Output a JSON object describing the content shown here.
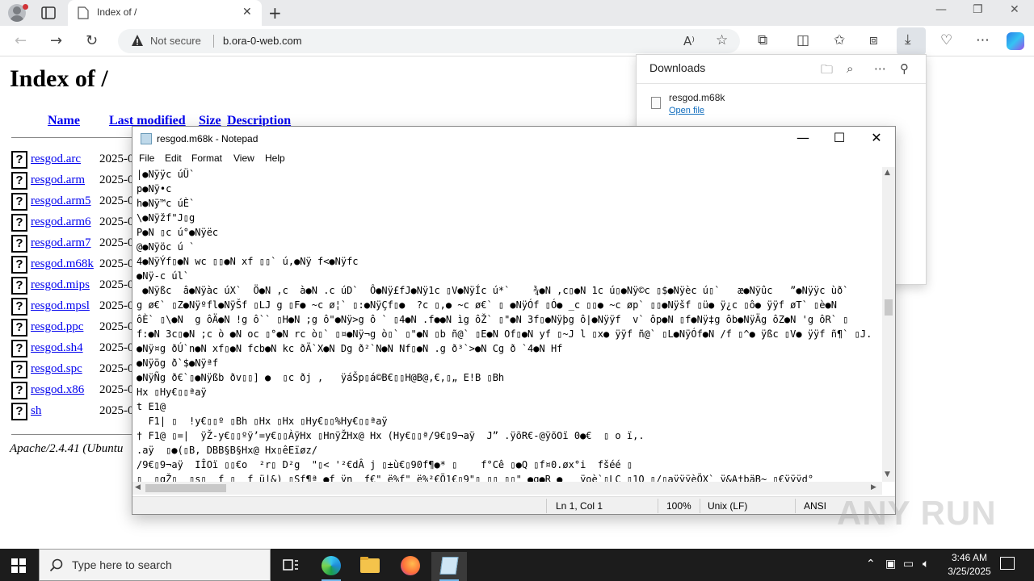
{
  "browser": {
    "tab_title": "Index of /",
    "address": {
      "security_label": "Not secure",
      "url": "b.ora-0-web.com"
    }
  },
  "page": {
    "heading": "Index of /",
    "columns": [
      "Name",
      "Last modified",
      "Size",
      "Description"
    ],
    "files": [
      {
        "name": "resgod.arc",
        "date": "2025-0"
      },
      {
        "name": "resgod.arm",
        "date": "2025-0"
      },
      {
        "name": "resgod.arm5",
        "date": "2025-0"
      },
      {
        "name": "resgod.arm6",
        "date": "2025-0"
      },
      {
        "name": "resgod.arm7",
        "date": "2025-0"
      },
      {
        "name": "resgod.m68k",
        "date": "2025-0"
      },
      {
        "name": "resgod.mips",
        "date": "2025-0"
      },
      {
        "name": "resgod.mpsl",
        "date": "2025-0"
      },
      {
        "name": "resgod.ppc",
        "date": "2025-0"
      },
      {
        "name": "resgod.sh4",
        "date": "2025-0"
      },
      {
        "name": "resgod.spc",
        "date": "2025-0"
      },
      {
        "name": "resgod.x86",
        "date": "2025-0"
      },
      {
        "name": "sh",
        "date": "2025-0"
      }
    ],
    "footer": "Apache/2.4.41 (Ubuntu"
  },
  "downloads": {
    "title": "Downloads",
    "items": [
      {
        "filename": "resgod.m68k",
        "action": "Open file"
      }
    ]
  },
  "notepad": {
    "title": "resgod.m68k - Notepad",
    "menu": [
      "File",
      "Edit",
      "Format",
      "View",
      "Help"
    ],
    "lines": [
      "|●Nÿÿc úÜ`",
      "p●Nÿ•c",
      "h●Nÿ™c úÈ`",
      "\\●Nÿžf\"J▯g",
      "P●N ▯c ú°●Nÿëc",
      "@●Nÿöc ú `",
      "4●NÿÝf▯●N wc ▯▯●N xf ▯▯` ú,●Nÿ f<●Nÿfc",
      "●Nÿ-c úl`",
      " ●Nÿßc  â●Nÿàc úX`  Ö●N ,c  à●N .c úD`  Ô●Nÿ£fJ●Nÿ1c ▯V●NÿÍc ú*`    ¾●N ,c▯●N 1c ú▯●Nÿ©c ▯$●Nÿèc ú▯`   æ●Nÿûc   ”●Nÿÿc ùð`",
      "g ø€` ▯Z●Nÿºfl●NÿŠf ▯LJ g ▯F● ~c ø¦` ▯:●NÿÇf▯●  ?c ▯,● ~c ø€` ▯ ●NÿÓf ▯Ó● _c ▯▯● ~c øp` ▯▯●Nÿšf ▯ü● ÿ¿c ▯ô● ÿÿf øT` ▯è●N",
      "ôÈ` ▯\\●N  g ôÄ●N !g ô`` ▯H●N ;g ô\"●Nÿ>g ô ` ▯4●N .f●●N ìg ôŽ` ▯\"●N 3f▯●Nÿþg ô|●Nÿÿf  v` ôp●N ▯f●Nÿ‡g ôb●NÿÄg ôZ●N 'g ôR` ▯",
      "f:●N 3c▯●N ;c ò ●N oc ▯°●N rc ò▯` ▯¤●Nÿ¬g ò▯` ▯\"●N ▯b ñ@` ▯E●N Of▯●N yf ▯~J l ▯x● ÿÿf ñ@` ▯L●NÿÓf●N /f ▯^● ÿßc ▯V● ÿÿf ñ¶` ▯J.",
      "●Nÿ¤g ðÚ`n●N xf▯●N fcb●N kc ðÄ`X●N Dg ð²`N●N Nf▯●N .g ð³`>●N Cg ð `4●N Hf",
      "●Nÿög ð`$●Nÿªf",
      "●NÿÑg ð€`▯●Nÿßb ðv▯▯] ●  ▯c ðj ,   ÿáŠp▯á©B€▯▯H@B@,€,▯„ E!B ▯Bh",
      "Hx ▯Hy€▯▯ªaÿ",
      "t E1@",
      "  F1| ▯  !y€▯▯º ▯Bh ▯Hx ▯Hx ▯Hy€▯▯%Hy€▯▯ªaÿ",
      "† F1@ ▯=|  ÿŽ-y€▯▯ºÿ’=y€▯▯ÀÿHx ▯HnÿŽHx@ Hx (Hy€▯▯ª/9€▯9¬aÿ  J” .ÿõR€-@ÿõOï 0●€  ▯ o ï,.",
      ".aÿ  ▯●(▯B, DBB§B§Hx@ Hx▯êEïøz/",
      "/9€▯9¬aÿ  IÎOï ▯▯€o  ²r▯ D²g  \"▯< '²€dÂ j ▯±ù€▯90f¶●* ▯    f°Cê ▯●Q ▯f¤0.øx°i  fšéé ▯",
      "▯  ▯gŽ▯  ▯s▯  f ▯  f ü|&) ▯Sf¶ª ●f ÿn  f€\" ë%f\" ë%²€Ö1€▯9\"▯ ▯▯ ▯▯\" ●g●R ●   ÿoè`▯LC ▯1Q ▯/▯aÿÿÿèÖX` ÿ&A†bäB~ ▯€ÿÿÿd°"
    ],
    "status": {
      "position": "Ln 1, Col 1",
      "zoom": "100%",
      "line_ending": "Unix (LF)",
      "encoding": "ANSI"
    }
  },
  "watermark": "ANY RUN",
  "taskbar": {
    "search_placeholder": "Type here to search",
    "time": "3:46 AM",
    "date": "3/25/2025"
  }
}
